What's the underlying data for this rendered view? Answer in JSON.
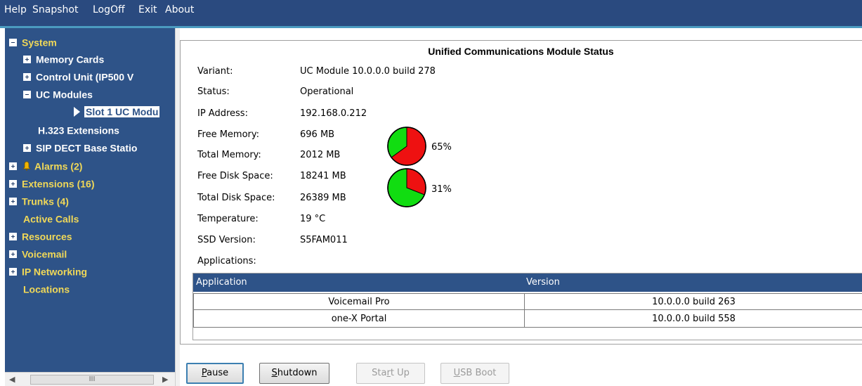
{
  "menu": {
    "help": "Help",
    "snapshot": "Snapshot",
    "logoff": "LogOff",
    "exit": "Exit",
    "about": "About"
  },
  "tree": {
    "system": "System",
    "memory_cards": "Memory Cards",
    "control_unit": "Control Unit (IP500 V",
    "uc_modules": "UC Modules",
    "slot1": "Slot 1 UC Modu",
    "h323": "H.323 Extensions",
    "sip_dect": "SIP DECT Base Statio",
    "alarms": "Alarms (2)",
    "extensions": "Extensions (16)",
    "trunks": "Trunks (4)",
    "active_calls": "Active Calls",
    "resources": "Resources",
    "voicemail": "Voicemail",
    "ip_networking": "IP Networking",
    "locations": "Locations"
  },
  "scroll": {
    "thumb_glyph": "III"
  },
  "status": {
    "title": "Unified Communications Module Status",
    "fields": [
      {
        "label": "Variant:",
        "value": "UC Module 10.0.0.0 build 278"
      },
      {
        "label": "Status:",
        "value": "Operational"
      },
      {
        "label": "IP Address:",
        "value": "192.168.0.212"
      },
      {
        "label": "Free Memory:",
        "value": "696 MB"
      },
      {
        "label": "Total Memory:",
        "value": "2012 MB"
      },
      {
        "label": "Free Disk Space:",
        "value": "18241 MB"
      },
      {
        "label": "Total Disk Space:",
        "value": "26389 MB"
      },
      {
        "label": "Temperature:",
        "value": "19 °C"
      },
      {
        "label": "SSD Version:",
        "value": "S5FAM011"
      },
      {
        "label": "Applications:",
        "value": ""
      }
    ],
    "memory_used_pct": 65,
    "memory_used_label": "65%",
    "disk_used_pct": 31,
    "disk_used_label": "31%"
  },
  "apps": {
    "headers": [
      "Application",
      "Version"
    ],
    "rows": [
      {
        "name": "Voicemail Pro",
        "version": "10.0.0.0 build 263"
      },
      {
        "name": "one-X Portal",
        "version": "10.0.0.0 build 558"
      }
    ]
  },
  "buttons": {
    "pause_pre": "",
    "pause_u": "P",
    "pause_post": "ause",
    "shutdown_pre": "",
    "shutdown_u": "S",
    "shutdown_post": "hutdown",
    "startup_pre": "Sta",
    "startup_u": "r",
    "startup_post": "t Up",
    "usb_pre": "",
    "usb_u": "U",
    "usb_post": "SB Boot"
  },
  "colors": {
    "menubar": "#2a4a7f",
    "sidebar": "#2e5388",
    "tree_top_level": "#f0d858",
    "pie_used": "#ee1111",
    "pie_free": "#11dd11"
  }
}
